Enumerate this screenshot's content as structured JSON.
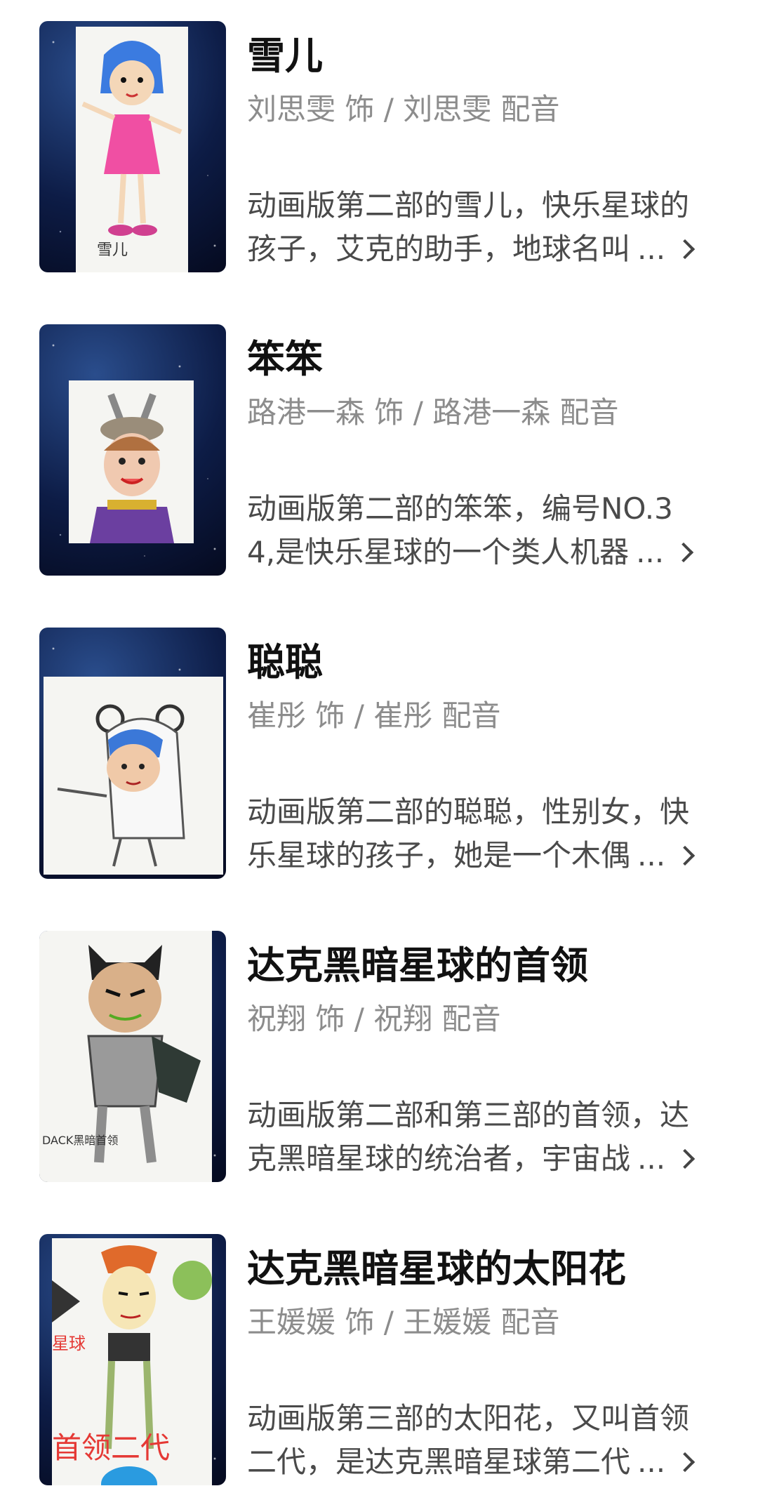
{
  "characters": [
    {
      "name": "雪儿",
      "cast": "刘思雯 饰 / 刘思雯 配音",
      "desc_line1": "动画版第二部的雪儿，快乐星球的",
      "desc_line2": "孩子，艾克的助手，地球名叫",
      "more": "...",
      "paper_text": "雪儿"
    },
    {
      "name": "笨笨",
      "cast": "路港一森 饰 / 路港一森 配音",
      "desc_line1": "动画版第二部的笨笨，编号NO.3",
      "desc_line2": "4,是快乐星球的一个类人机器",
      "more": "..."
    },
    {
      "name": "聪聪",
      "cast": "崔彤 饰 / 崔彤 配音",
      "desc_line1": "动画版第二部的聪聪，性别女，快",
      "desc_line2": "乐星球的孩子，她是一个木偶",
      "more": "..."
    },
    {
      "name": "达克黑暗星球的首领",
      "cast": "祝翔 饰 / 祝翔 配音",
      "desc_line1": "动画版第二部和第三部的首领，达",
      "desc_line2": "克黑暗星球的统治者，宇宙战",
      "more": "...",
      "paper_text": "DACK黑暗首领"
    },
    {
      "name": "达克黑暗星球的太阳花",
      "cast": "王媛媛 饰 / 王媛媛 配音",
      "desc_line1": "动画版第三部的太阳花，又叫首领",
      "desc_line2": "二代，是达克黑暗星球第二代",
      "more": "...",
      "paper_text_1": "星球",
      "paper_text_2": "首领二代"
    }
  ],
  "icons": {
    "chevron": "chevron-right-icon"
  }
}
